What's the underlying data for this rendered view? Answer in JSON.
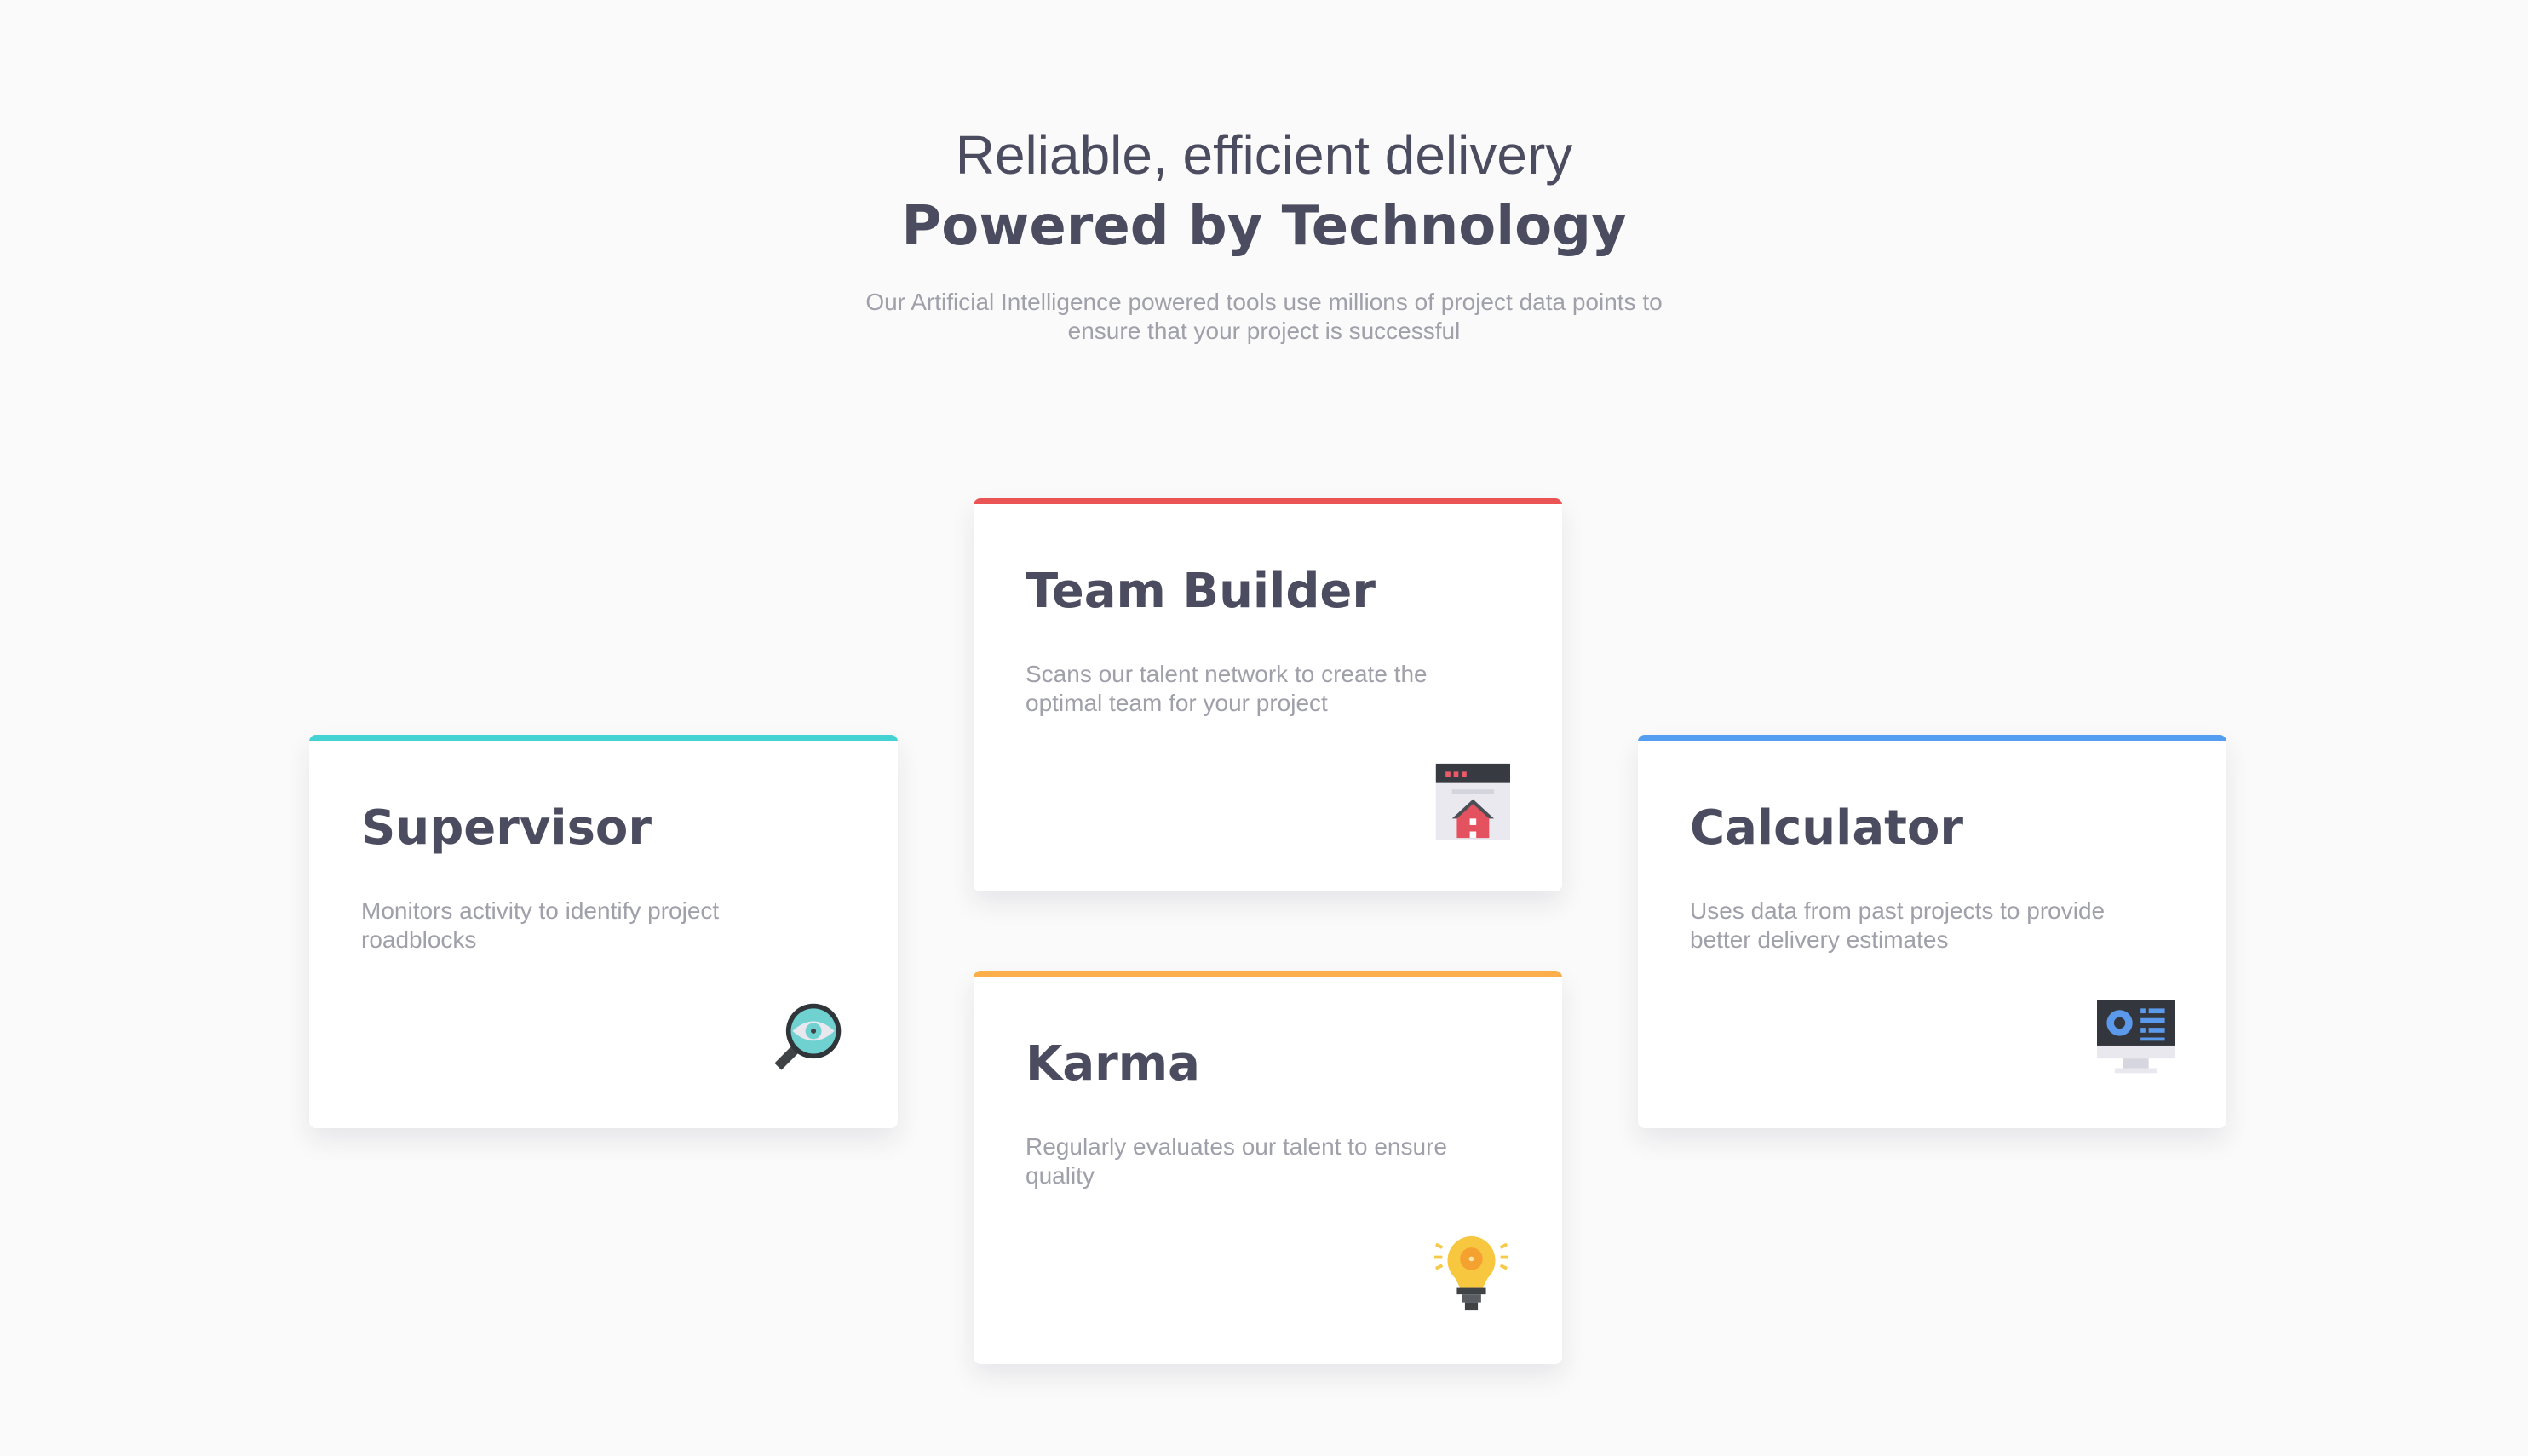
{
  "hero": {
    "title_light": "Reliable, efficient delivery",
    "title_bold": "Powered by Technology",
    "description": "Our Artificial Intelligence powered tools use millions of project data points to ensure that your project is successful"
  },
  "cards": [
    {
      "title": "Supervisor",
      "description": "Monitors activity to identify project roadblocks",
      "accent": "#44d3d2",
      "icon": "magnifier-eye-icon"
    },
    {
      "title": "Team Builder",
      "description": "Scans our talent network to create the optimal team for your project",
      "accent": "#ea5454",
      "icon": "browser-house-icon"
    },
    {
      "title": "Karma",
      "description": "Regularly evaluates our talent to ensure quality",
      "accent": "#fcae4a",
      "icon": "lightbulb-gear-icon"
    },
    {
      "title": "Calculator",
      "description": "Uses data from past projects to provide better delivery estimates",
      "accent": "#549ef2",
      "icon": "monitor-chart-icon"
    }
  ]
}
